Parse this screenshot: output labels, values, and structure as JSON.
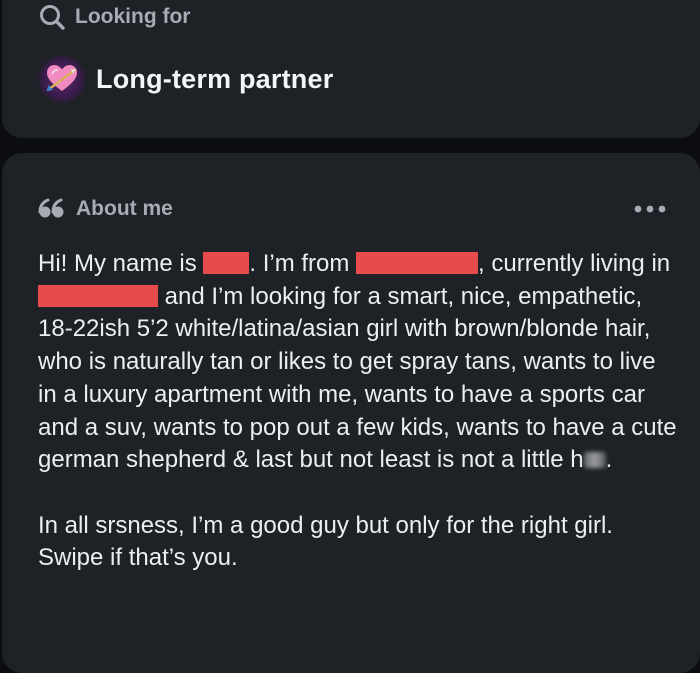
{
  "looking_for": {
    "header_label": "Looking for",
    "header_icon": "search-icon",
    "value_icon": "heart-with-arrow-icon",
    "value": "Long-term partner"
  },
  "about_me": {
    "header_label": "About me",
    "header_icon": "quote-icon",
    "more_icon": "more-options-icon",
    "paragraph_1": {
      "segment_1": "Hi! My name is ",
      "segment_2": ". I’m from ",
      "segment_3": ", currently living in ",
      "segment_4": " and I’m looking for a smart, nice, empathetic, 18-22ish 5’2 white/latina/asian girl with brown/blonde hair, who is naturally tan or likes to get spray tans, wants to live in a luxury apartment with me, wants to have a sports car and a suv, wants to pop out a few kids, wants to have a cute german shepherd & last but not least is not a little h",
      "segment_5": "."
    },
    "paragraph_2": "In all srsness, I’m a good guy but only for the right girl. Swipe if that’s you."
  },
  "colors": {
    "background": "#0c0d11",
    "card": "#1e2126",
    "redaction": "#e84b4c",
    "muted_text": "#a7abb3"
  }
}
